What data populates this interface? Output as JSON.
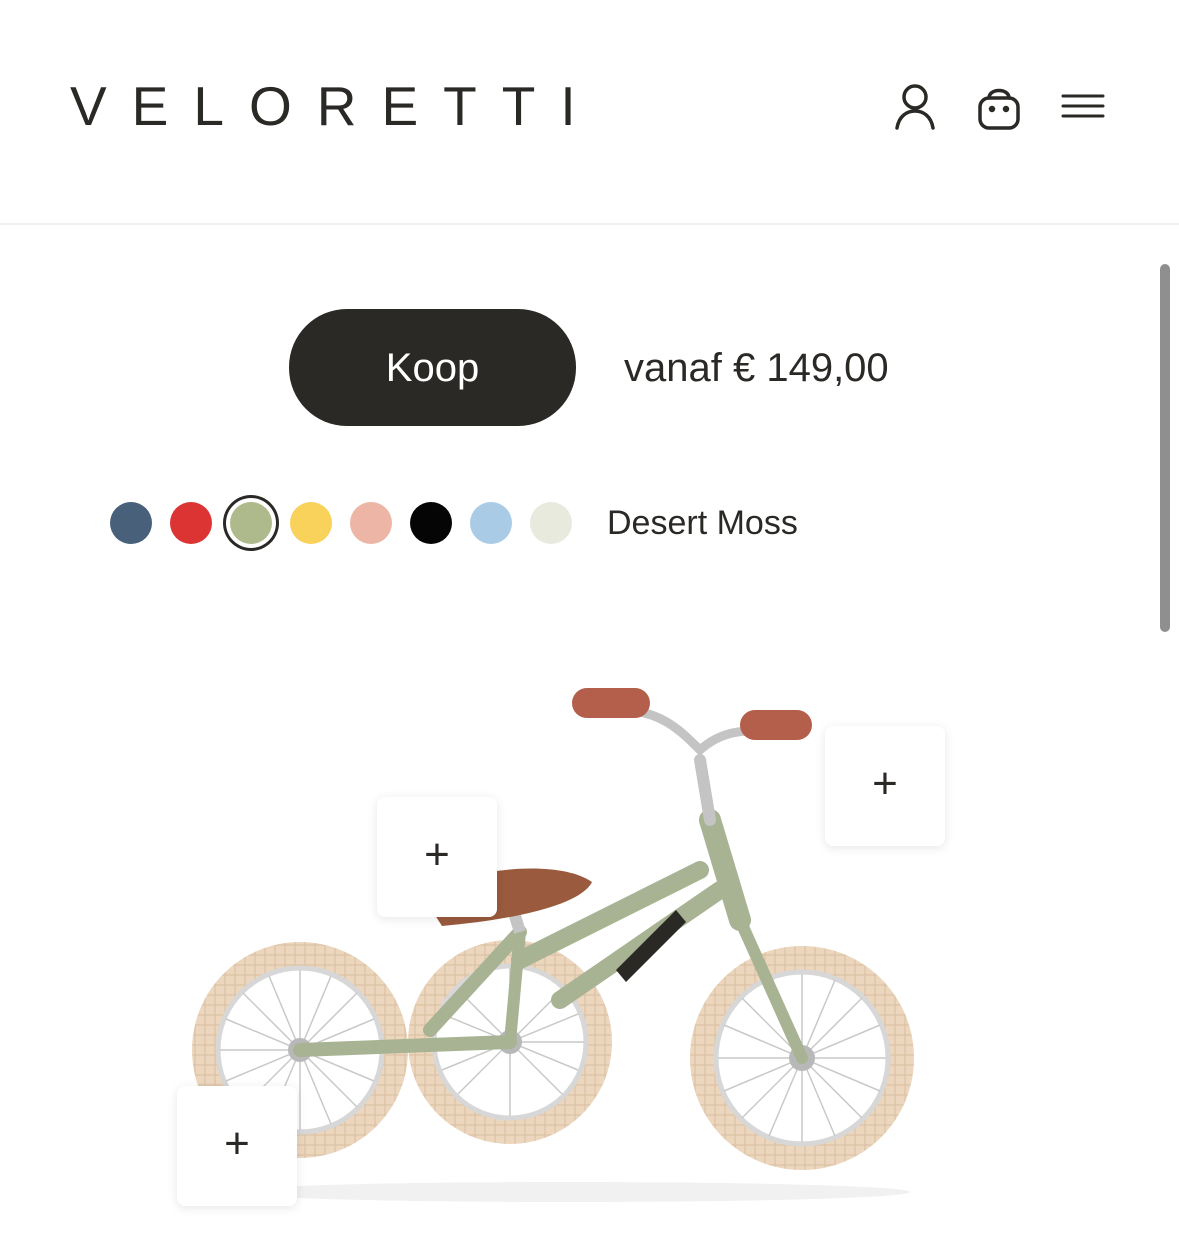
{
  "header": {
    "logo": "VELORETTI",
    "icons": [
      "account-icon",
      "bag-icon",
      "menu-icon"
    ]
  },
  "buy": {
    "button_label": "Koop",
    "price": "vanaf € 149,00"
  },
  "colors": {
    "selected_name": "Desert Moss",
    "swatches": [
      "#48607a",
      "#dc3333",
      "#aeba8c",
      "#f8d25b",
      "#ecb5a5",
      "#050505",
      "#a9cbe6",
      "#e8eadd"
    ],
    "selected_index": 2
  },
  "hotspots": {
    "symbol": "+"
  },
  "accent": "#2b2926"
}
